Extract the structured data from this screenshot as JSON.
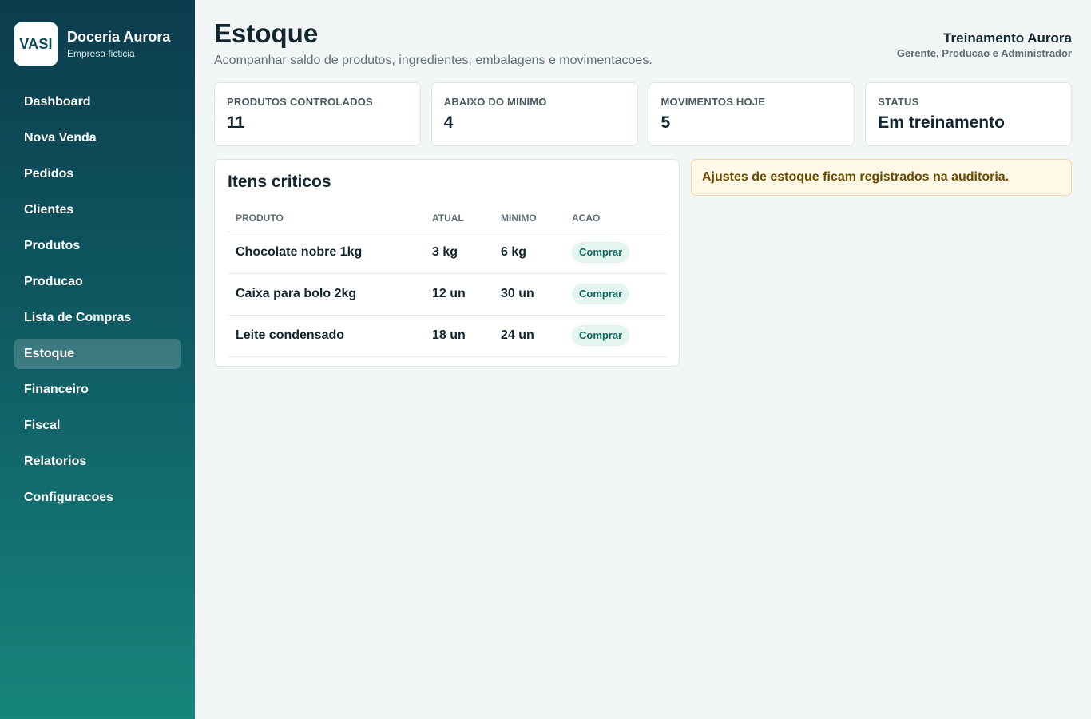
{
  "brand": {
    "logo_text": "VASI",
    "name": "Doceria Aurora",
    "subtitle": "Empresa ficticia"
  },
  "sidebar": {
    "items": [
      {
        "label": "Dashboard"
      },
      {
        "label": "Nova Venda"
      },
      {
        "label": "Pedidos"
      },
      {
        "label": "Clientes"
      },
      {
        "label": "Produtos"
      },
      {
        "label": "Producao"
      },
      {
        "label": "Lista de Compras"
      },
      {
        "label": "Estoque",
        "active": true
      },
      {
        "label": "Financeiro"
      },
      {
        "label": "Fiscal"
      },
      {
        "label": "Relatorios"
      },
      {
        "label": "Configuracoes"
      }
    ]
  },
  "header": {
    "title": "Estoque",
    "subtitle": "Acompanhar saldo de produtos, ingredientes, embalagens e movimentacoes."
  },
  "user": {
    "name": "Treinamento Aurora",
    "role": "Gerente, Producao e Administrador"
  },
  "stats": [
    {
      "label": "PRODUTOS CONTROLADOS",
      "value": "11"
    },
    {
      "label": "ABAIXO DO MINIMO",
      "value": "4"
    },
    {
      "label": "MOVIMENTOS HOJE",
      "value": "5"
    },
    {
      "label": "STATUS",
      "value": "Em treinamento"
    }
  ],
  "critical": {
    "title": "Itens criticos",
    "columns": [
      "PRODUTO",
      "ATUAL",
      "MINIMO",
      "ACAO"
    ],
    "rows": [
      {
        "produto": "Chocolate nobre 1kg",
        "atual": "3 kg",
        "minimo": "6 kg",
        "acao": "Comprar"
      },
      {
        "produto": "Caixa para bolo 2kg",
        "atual": "12 un",
        "minimo": "30 un",
        "acao": "Comprar"
      },
      {
        "produto": "Leite condensado",
        "atual": "18 un",
        "minimo": "24 un",
        "acao": "Comprar"
      }
    ]
  },
  "notice": {
    "text": "Ajustes de estoque ficam registrados na auditoria."
  },
  "colors": {
    "sidebar_top": "#0b3c4d",
    "sidebar_bottom": "#17857c",
    "badge_bg": "#e3f4f1",
    "badge_text": "#0e6b5c",
    "notice_bg": "#fff8e6",
    "notice_text": "#6b4a00"
  }
}
